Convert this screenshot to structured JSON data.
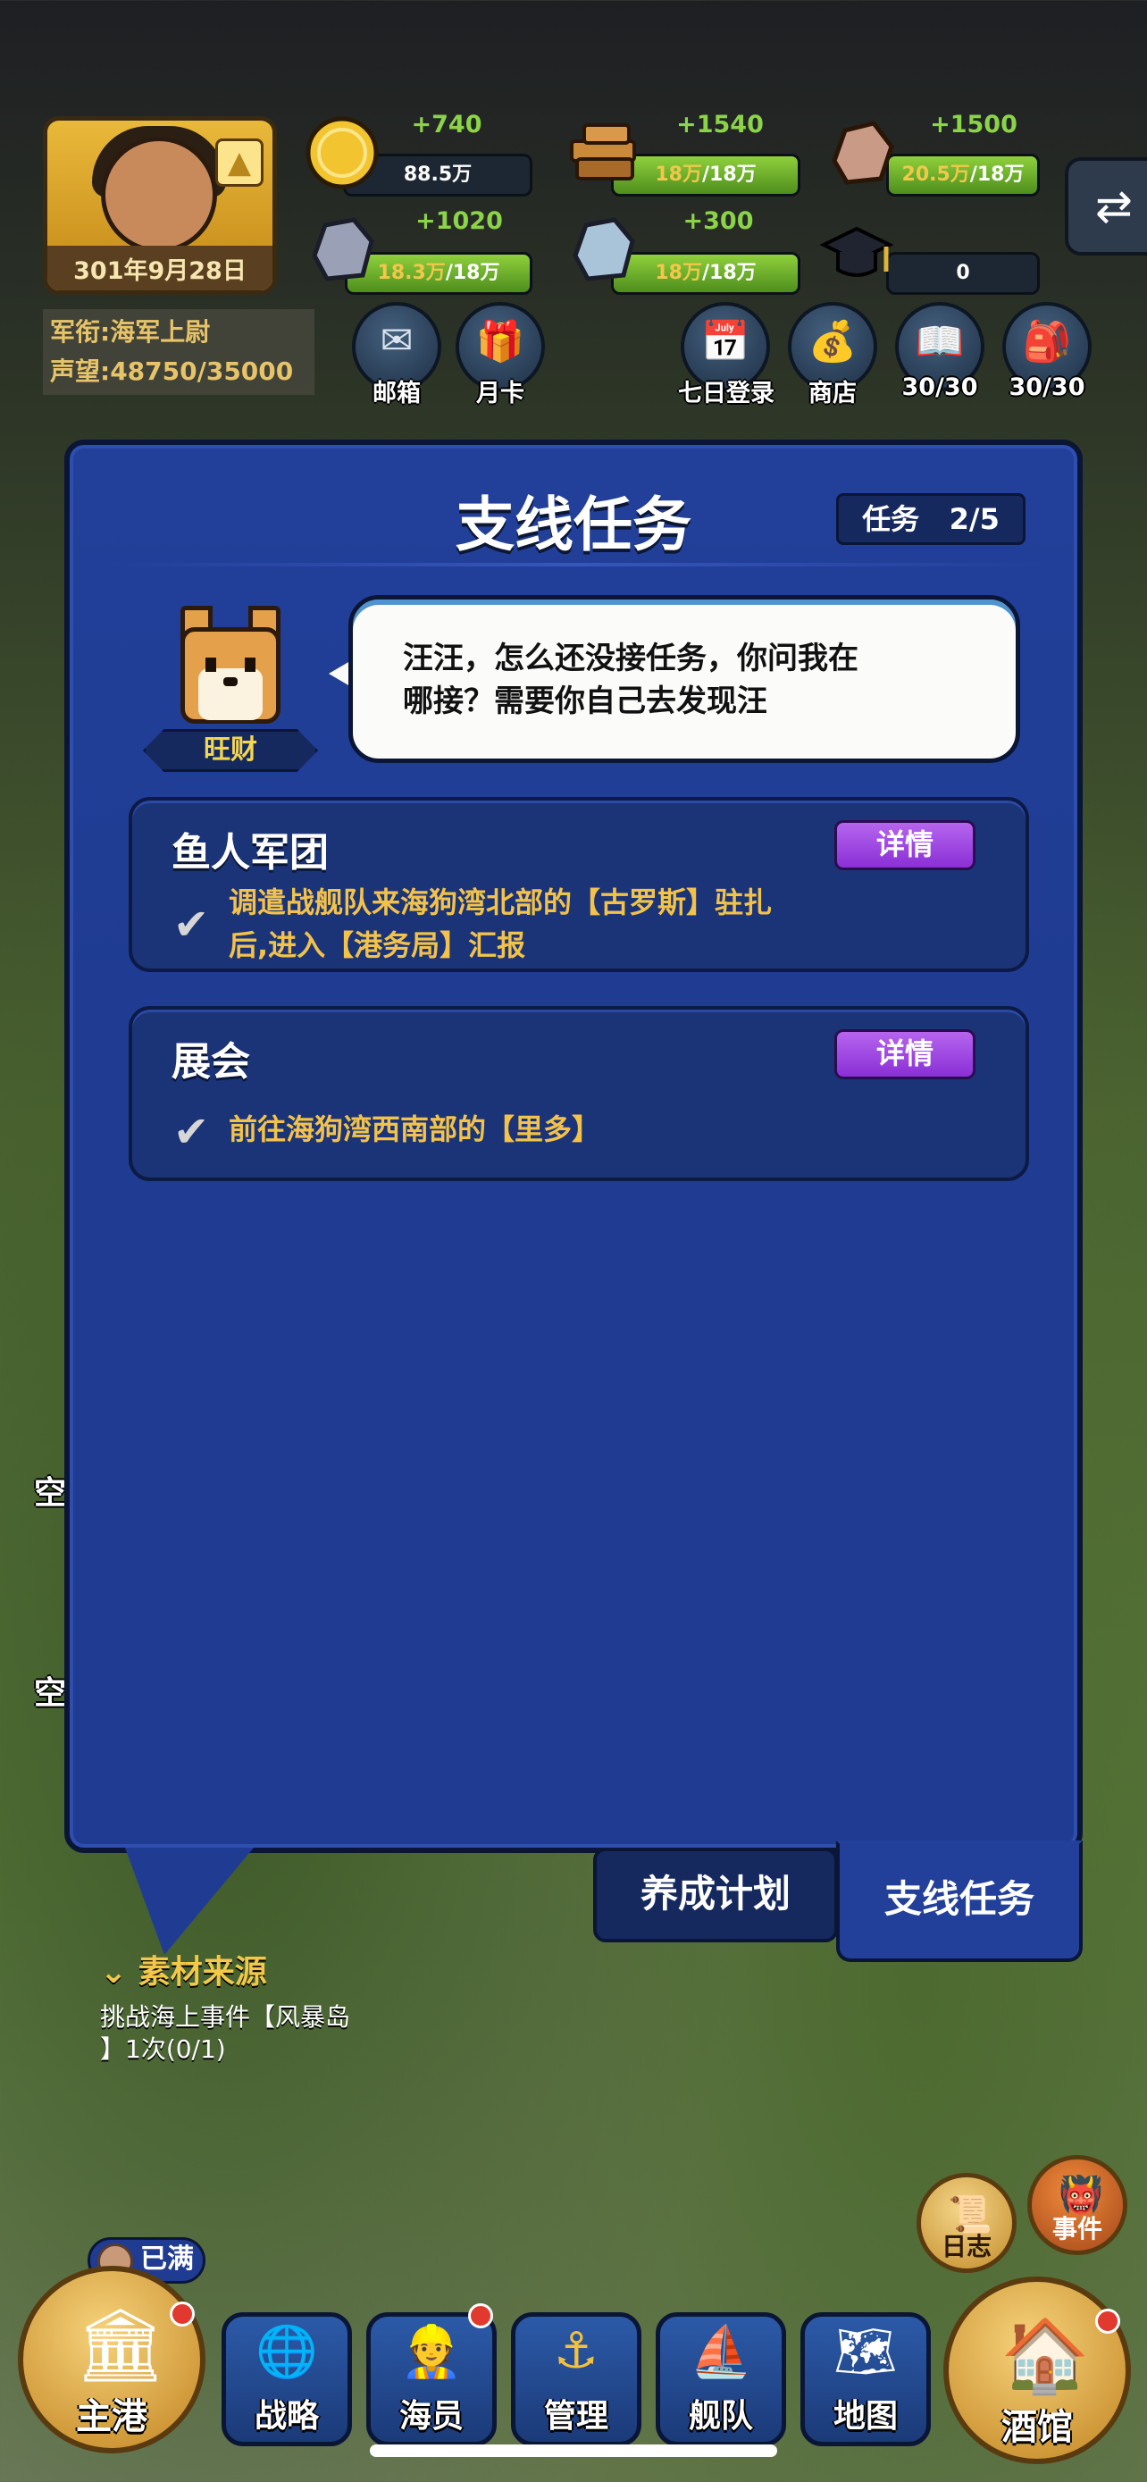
{
  "player": {
    "date": "301年9月28日",
    "rank": "军衔:海军上尉",
    "fame": "声望:48750/35000"
  },
  "resources": [
    {
      "name": "gold",
      "plus": "+740",
      "value": "88.5万",
      "fill": 0
    },
    {
      "name": "wood",
      "plus": "+1540",
      "value_low": "18万",
      "value_high": "/18万",
      "fill": 1.0
    },
    {
      "name": "stone",
      "plus": "+1500",
      "value_low": "20.5万",
      "value_high": "/18万",
      "fill": 1.0
    },
    {
      "name": "iron",
      "plus": "+1020",
      "value_low": "18.3万",
      "value_high": "/18万",
      "fill": 1.0
    },
    {
      "name": "crystal",
      "plus": "+300",
      "value_low": "18万",
      "value_high": "/18万",
      "fill": 1.0
    },
    {
      "name": "academy",
      "plus": "",
      "value": "0",
      "fill": 0
    }
  ],
  "hud_buttons": {
    "mail": "邮箱",
    "monthly_card": "月卡",
    "seven_day": "七日登录",
    "shop": "商店",
    "book": "30/30",
    "bag": "30/30"
  },
  "panel": {
    "title": "支线任务",
    "count_label": "任务",
    "count_value": "2/5",
    "npc_name": "旺财",
    "npc_line1": "汪汪，怎么还没接任务，你问我在",
    "npc_line2": "哪接？需要你自己去发现汪"
  },
  "tasks": [
    {
      "name": "鱼人军团",
      "detail": "详情",
      "desc_line1": "调遣战舰队来海狗湾北部的【古罗斯】驻扎",
      "desc_line2": "后,进入【港务局】汇报"
    },
    {
      "name": "展会",
      "detail": "详情",
      "desc_line1": "前往海狗湾西南部的【里多】"
    }
  ],
  "tabs": {
    "training": "养成计划",
    "side_quests": "支线任务"
  },
  "source": {
    "title": "素材来源",
    "desc_line1": "挑战海上事件【风暴岛",
    "desc_line2": "】1次(0/1)"
  },
  "side_left": [
    "空",
    "空"
  ],
  "side_buttons": {
    "log": "日志",
    "event": "事件"
  },
  "full_badge": "已满",
  "bottom_nav": {
    "harbor": "主港",
    "strategy": "战略",
    "crew": "海员",
    "manage": "管理",
    "fleet": "舰队",
    "map": "地图",
    "tavern": "酒馆"
  }
}
